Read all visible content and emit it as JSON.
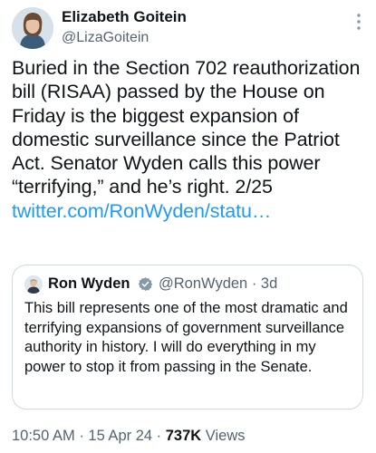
{
  "author": {
    "name": "Elizabeth Goitein",
    "handle": "@LizaGoitein"
  },
  "tweet": {
    "text": "Buried in the Section 702 reauthorization bill (RISAA) passed by the House on Friday is the biggest expansion of domestic surveillance since the Patriot Act. Senator Wyden calls this power “terrifying,” and he’s right. 2/25 ",
    "link": "twitter.com/RonWyden/statu…"
  },
  "quote": {
    "name": "Ron Wyden",
    "handle": "@RonWyden",
    "separator": "·",
    "time": "3d",
    "text": "This bill represents one of the most dramatic and terrifying expansions of government surveillance authority in history. I will do everything in my power to stop it from passing in the Senate."
  },
  "meta": {
    "time": "10:50 AM",
    "separator": "·",
    "date": "15 Apr 24",
    "views_count": "737K",
    "views_label": "Views"
  },
  "icons": {
    "more": "more-vertical-icon",
    "verified": "verified-badge-icon"
  },
  "colors": {
    "link": "#1d9bf0",
    "secondary_text": "#536471",
    "border": "#cfd9de",
    "primary_text": "#0f1419"
  }
}
